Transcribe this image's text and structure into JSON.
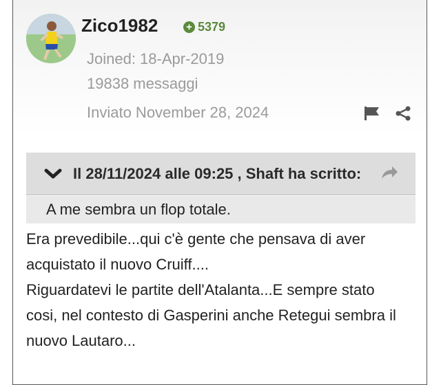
{
  "post": {
    "author": {
      "username": "Zico1982",
      "reputation": "5379",
      "joined": "Joined: 18-Apr-2019",
      "messages": "19838 messaggi"
    },
    "posted": "Inviato November 28, 2024",
    "icons": {
      "report": "flag-icon",
      "share": "share-icon",
      "reputation": "plus-circle-icon"
    },
    "quote": {
      "header": "Il 28/11/2024 alle 09:25 , Shaft ha scritto:",
      "text": "A me sembra un flop totale."
    },
    "body_lines": [
      "Era prevedibile...qui c'è gente che pensava di aver",
      "acquistato il nuovo Cruiff....",
      "Riguardatevi le partite dell'Atalanta...E sempre stato",
      "cosi, nel contesto di Gasperini anche Retegui sembra il",
      "nuovo Lautaro..."
    ]
  },
  "colors": {
    "reputation_green": "#5b8a3c",
    "meta_gray": "#9a9a9a",
    "quote_header_bg": "#dddddd",
    "quote_body_bg": "#e9e9e9"
  }
}
